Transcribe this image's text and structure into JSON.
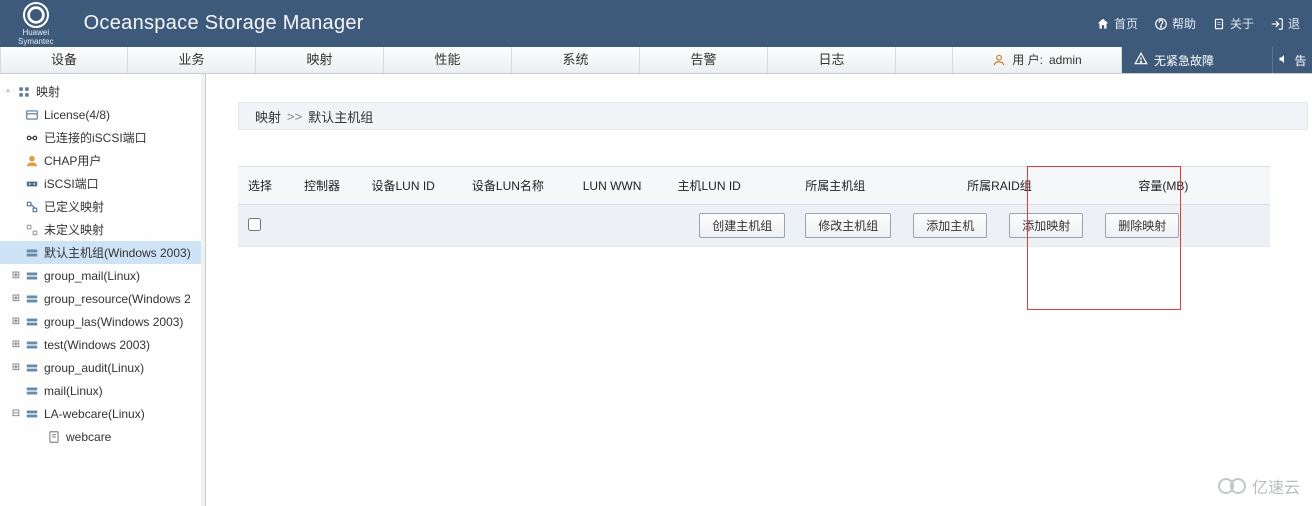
{
  "header": {
    "logo_text_top": "Huawei",
    "logo_text_bottom": "Symantec",
    "title": "Oceanspace Storage Manager",
    "links": {
      "home": "首页",
      "help": "帮助",
      "about": "关于",
      "logout": "退"
    }
  },
  "nav": {
    "items": [
      "设备",
      "业务",
      "映射",
      "性能",
      "系统",
      "告警",
      "日志"
    ],
    "user_prefix": "用 户:",
    "user_name": "admin",
    "status": "无紧急故障",
    "alert_suffix": "告"
  },
  "sidebar": {
    "root": "映射",
    "items": [
      {
        "label": "License(4/8)",
        "icon": "license-icon",
        "expander": ""
      },
      {
        "label": "已连接的iSCSI端口",
        "icon": "port-icon",
        "expander": ""
      },
      {
        "label": "CHAP用户",
        "icon": "chap-user-icon",
        "expander": ""
      },
      {
        "label": "iSCSI端口",
        "icon": "iscsi-port-icon",
        "expander": ""
      },
      {
        "label": "已定义映射",
        "icon": "map-defined-icon",
        "expander": ""
      },
      {
        "label": "未定义映射",
        "icon": "map-undefined-icon",
        "expander": ""
      },
      {
        "label": "默认主机组(Windows 2003)",
        "icon": "hostgroup-icon",
        "expander": "",
        "selected": true
      },
      {
        "label": "group_mail(Linux)",
        "icon": "hostgroup-icon",
        "expander": "+"
      },
      {
        "label": "group_resource(Windows 2",
        "icon": "hostgroup-icon",
        "expander": "+"
      },
      {
        "label": "group_las(Windows 2003)",
        "icon": "hostgroup-icon",
        "expander": "+"
      },
      {
        "label": "test(Windows 2003)",
        "icon": "hostgroup-icon",
        "expander": "+"
      },
      {
        "label": "group_audit(Linux)",
        "icon": "hostgroup-icon",
        "expander": "+"
      },
      {
        "label": "mail(Linux)",
        "icon": "hostgroup-icon",
        "expander": ""
      },
      {
        "label": "LA-webcare(Linux)",
        "icon": "hostgroup-icon",
        "expander": "-",
        "children": [
          {
            "label": "webcare",
            "icon": "host-icon"
          }
        ]
      }
    ]
  },
  "breadcrumb": {
    "part1": "映射",
    "sep": ">>",
    "part2": "默认主机组"
  },
  "table": {
    "columns": [
      "选择",
      "控制器",
      "设备LUN ID",
      "设备LUN名称",
      "LUN WWN",
      "主机LUN ID",
      "所属主机组",
      "所属RAID组",
      "容量(MB)"
    ]
  },
  "buttons": {
    "create_hostgroup": "创建主机组",
    "modify_hostgroup": "修改主机组",
    "add_host": "添加主机",
    "add_mapping": "添加映射",
    "delete_mapping": "删除映射"
  },
  "watermark": "亿速云"
}
